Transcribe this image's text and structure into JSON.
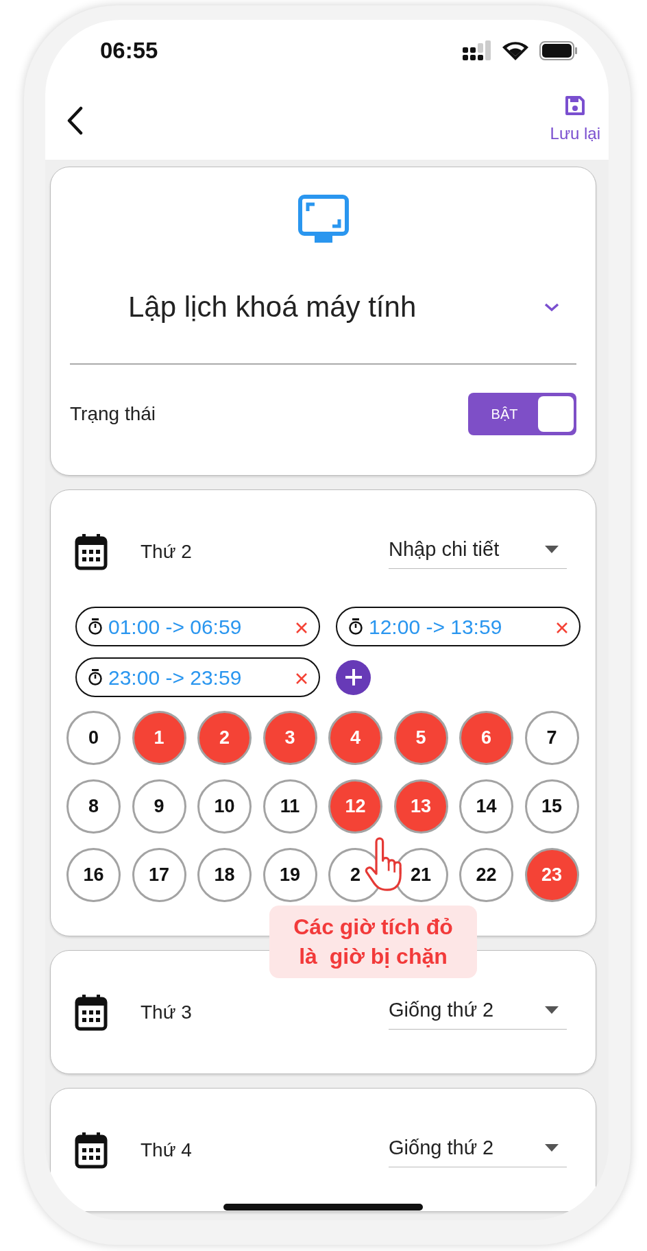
{
  "status_bar": {
    "time": "06:55"
  },
  "header": {
    "save_label": "Lưu lại"
  },
  "lock_card": {
    "title": "Lập lịch khoá máy tính",
    "status_label": "Trạng thái",
    "toggle": {
      "label": "BẬT",
      "on": true
    }
  },
  "days": [
    {
      "name": "Thứ 2",
      "mode": "Nhập chi tiết",
      "ranges": [
        {
          "text": "01:00 -> 06:59"
        },
        {
          "text": "12:00 -> 13:59"
        },
        {
          "text": "23:00 -> 23:59"
        }
      ],
      "hours": [
        {
          "label": "0",
          "selected": false
        },
        {
          "label": "1",
          "selected": true
        },
        {
          "label": "2",
          "selected": true
        },
        {
          "label": "3",
          "selected": true
        },
        {
          "label": "4",
          "selected": true
        },
        {
          "label": "5",
          "selected": true
        },
        {
          "label": "6",
          "selected": true
        },
        {
          "label": "7",
          "selected": false
        },
        {
          "label": "8",
          "selected": false
        },
        {
          "label": "9",
          "selected": false
        },
        {
          "label": "10",
          "selected": false
        },
        {
          "label": "11",
          "selected": false
        },
        {
          "label": "12",
          "selected": true
        },
        {
          "label": "13",
          "selected": true
        },
        {
          "label": "14",
          "selected": false
        },
        {
          "label": "15",
          "selected": false
        },
        {
          "label": "16",
          "selected": false
        },
        {
          "label": "17",
          "selected": false
        },
        {
          "label": "18",
          "selected": false
        },
        {
          "label": "19",
          "selected": false
        },
        {
          "label": "2",
          "selected": false
        },
        {
          "label": "21",
          "selected": false
        },
        {
          "label": "22",
          "selected": false
        },
        {
          "label": "23",
          "selected": true
        }
      ]
    },
    {
      "name": "Thứ 3",
      "mode": "Giống thứ 2"
    },
    {
      "name": "Thứ 4",
      "mode": "Giống thứ 2"
    }
  ],
  "tooltip": {
    "text": "Các giờ tích đỏ\nlà  giờ bị chặn"
  }
}
